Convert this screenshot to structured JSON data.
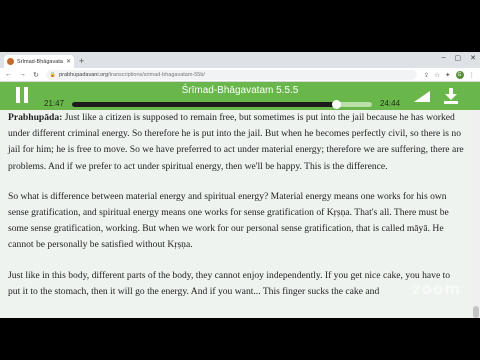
{
  "browser": {
    "tab_title": "Śrīmad-Bhāgavatam 5.5.5",
    "new_tab": "+",
    "url_domain": "prabhupadavani.org",
    "url_path": "/transcriptions/srimad-bhagavatam-55b/",
    "profile_initial": "G"
  },
  "player": {
    "title": "Śrīmad-Bhāgavatam 5.5.5",
    "current_time": "21:47",
    "duration": "24:44",
    "progress": 0.88
  },
  "paragraphs": [
    {
      "speaker": "Prabhupāda:",
      "text": " Just like a citizen is supposed to remain free, but sometimes is put into the jail because he has worked under different criminal energy. So therefore he is put into the jail. But when he becomes perfectly civil, so there is no jail for him; he is free to move. So we have preferred to act under material energy; therefore we are suffering, there are problems. And if we prefer to act under spiritual energy, then we'll be happy. This is the difference."
    },
    {
      "speaker": "",
      "text": "So what is difference between material energy and spiritual energy? Material energy means one works for his own sense gratification, and spiritual energy means one works for sense gratification of Kṛṣṇa. That's all. There must be some sense gratification, working. But when we work for our personal sense gratification, that is called māyā. He cannot be personally be satisfied without Kṛṣṇa."
    },
    {
      "speaker": "",
      "text": "Just like in this body, different parts of the body, they cannot enjoy independently. If you get nice cake, you have to put it to the stomach, then it will go the energy. And if you want... This finger sucks the cake and"
    }
  ],
  "watermark": "zoom",
  "colors": {
    "player_green": "#69b74b",
    "page_background": "#eef3f0"
  }
}
